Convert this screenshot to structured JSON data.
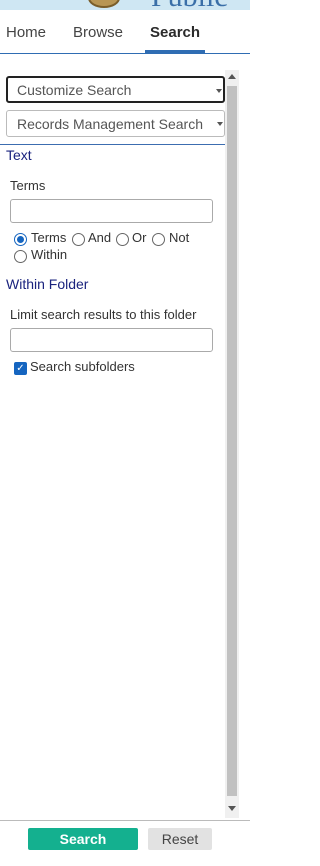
{
  "banner": {
    "title": "Public"
  },
  "nav": {
    "tabs": [
      {
        "label": "Home"
      },
      {
        "label": "Browse"
      },
      {
        "label": "Search",
        "active": true
      }
    ]
  },
  "search_panel": {
    "customize_select": "Customize Search",
    "search_type_select": "Records Management Search",
    "text_section": {
      "title": "Text",
      "terms_label": "Terms",
      "terms_value": "",
      "options": [
        {
          "label": "Terms",
          "checked": true
        },
        {
          "label": "And",
          "checked": false
        },
        {
          "label": "Or",
          "checked": false
        },
        {
          "label": "Not",
          "checked": false
        },
        {
          "label": "Within",
          "checked": false
        }
      ]
    },
    "folder_section": {
      "title": "Within Folder",
      "limit_label": "Limit search results to this folder",
      "folder_value": "",
      "subfolders_label": "Search subfolders",
      "subfolders_checked": true
    }
  },
  "footer": {
    "search_label": "Search",
    "reset_label": "Reset"
  },
  "colors": {
    "accent": "#2f6db3",
    "section_title": "#1a237e",
    "search_button": "#14b08f",
    "reset_button": "#e2e2e2"
  }
}
